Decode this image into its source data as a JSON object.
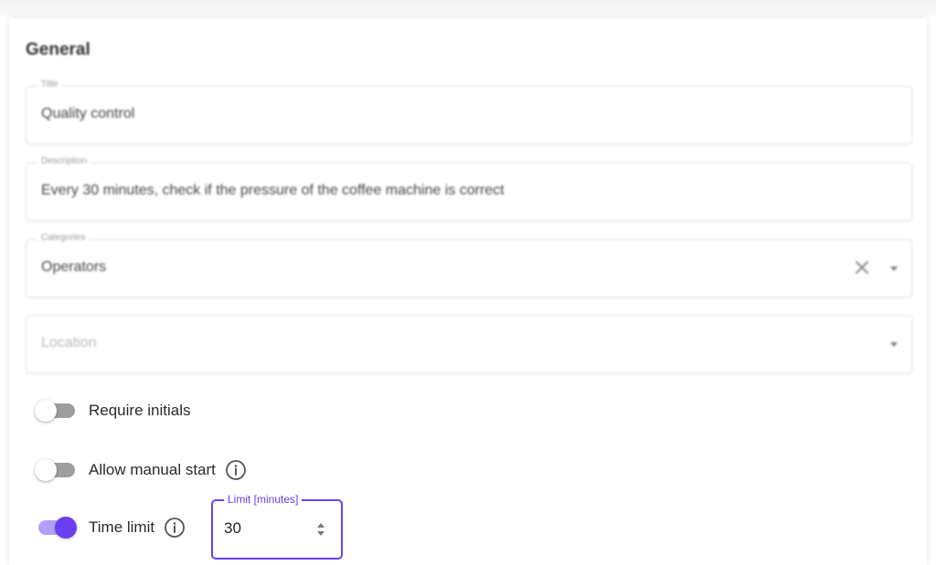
{
  "general": {
    "section_title": "General"
  },
  "fields": {
    "title": {
      "label": "Title",
      "value": "Quality control"
    },
    "description": {
      "label": "Description",
      "value": "Every 30 minutes, check if the pressure of the coffee machine is correct"
    },
    "categories": {
      "label": "Categories",
      "value": "Operators"
    },
    "location": {
      "placeholder": "Location"
    }
  },
  "toggles": {
    "require_initials": {
      "label": "Require initials",
      "on": false
    },
    "allow_manual_start": {
      "label": "Allow manual start",
      "on": false
    },
    "time_limit": {
      "label": "Time limit",
      "on": true
    }
  },
  "limit": {
    "label": "Limit [minutes]",
    "value": "30"
  },
  "colors": {
    "accent": "#6a3ff0",
    "accent_light": "#b3a0f6",
    "toggle_off": "#9e9e9e"
  },
  "icons": {
    "clear": "close-icon",
    "dropdown": "caret-down-icon",
    "info": "info-icon",
    "spinner": "up-down-arrows-icon"
  }
}
